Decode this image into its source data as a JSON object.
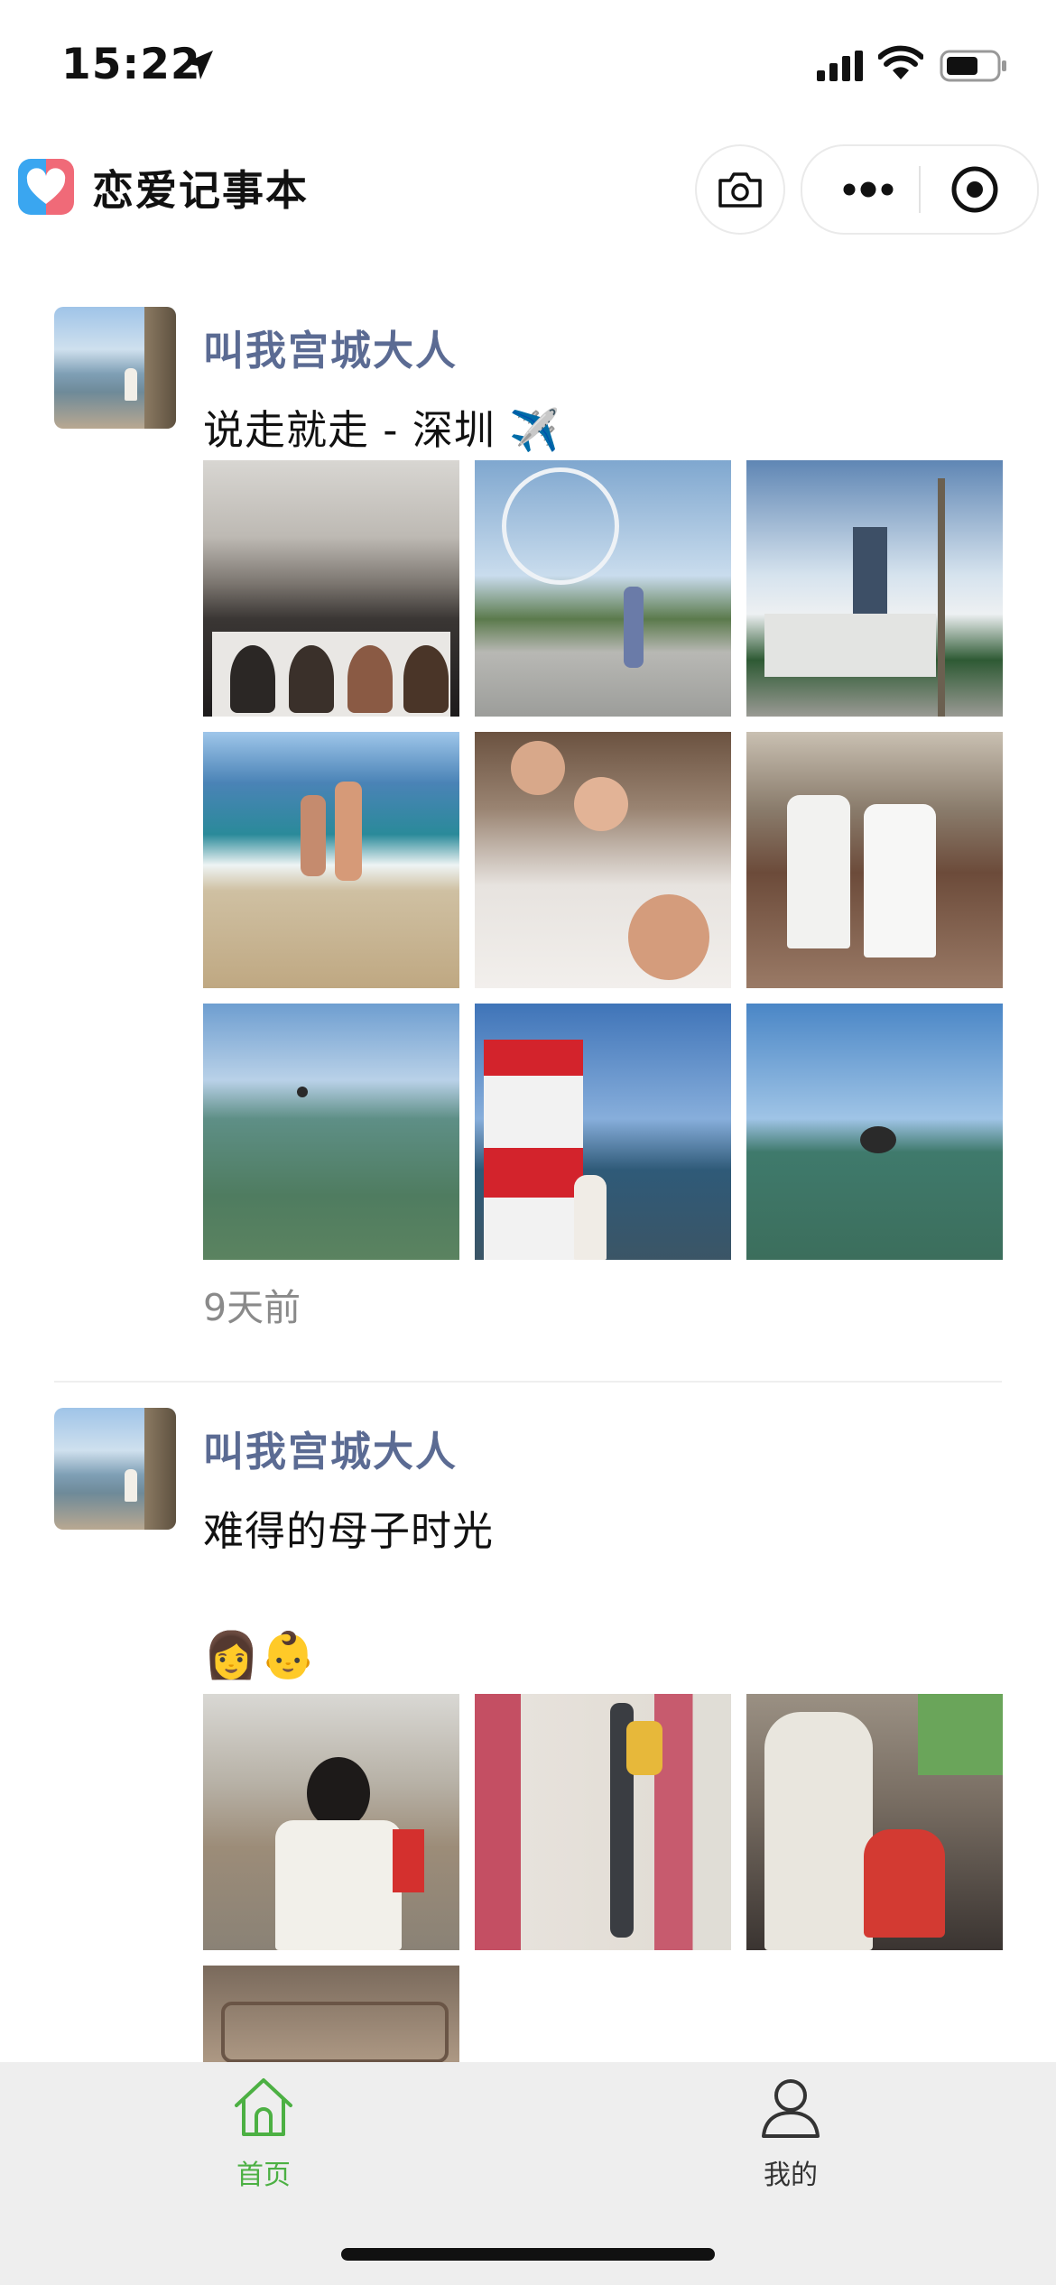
{
  "status_bar": {
    "time": "15:22"
  },
  "header": {
    "title": "恋爱记事本"
  },
  "posts": [
    {
      "username": "叫我宫城大人",
      "text": "说走就走 - 深圳 ✈️",
      "time": "9天前",
      "photos": [
        "train-tv",
        "ferris-wheel",
        "skyscraper-palm",
        "beach-couple",
        "dinner-selfie",
        "restaurant-friends",
        "sea-swimmer",
        "lighthouse",
        "sea-wave"
      ]
    },
    {
      "username": "叫我宫城大人",
      "text_line1": "难得的母子时光",
      "text_line2": "👩👶",
      "photos": [
        "mother-baby-chair",
        "mall-walk",
        "mother-baby-car",
        "car-interior"
      ]
    }
  ],
  "tabbar": {
    "tabs": [
      {
        "label": "首页",
        "icon": "home-icon",
        "active": true
      },
      {
        "label": "我的",
        "icon": "person-icon",
        "active": false
      }
    ],
    "active_color": "#4cb043",
    "inactive_color": "#333333"
  }
}
